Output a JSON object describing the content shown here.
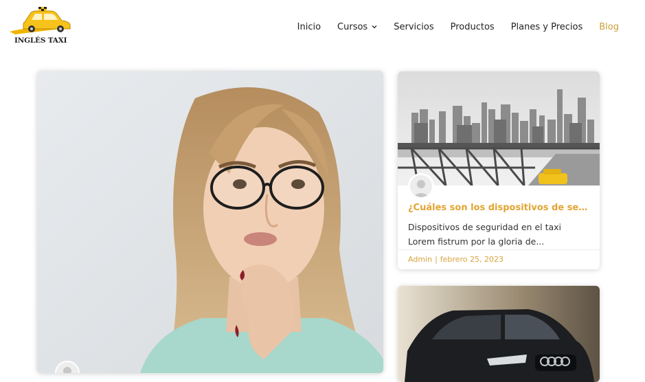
{
  "brand": {
    "name": "INGLÉS TAXI",
    "accent": "#f5b800"
  },
  "nav": {
    "items": [
      {
        "label": "Inicio"
      },
      {
        "label": "Cursos"
      },
      {
        "label": "Servicios"
      },
      {
        "label": "Productos"
      },
      {
        "label": "Planes y Precios"
      },
      {
        "label": "Blog"
      }
    ],
    "active_color": "#c9a13a"
  },
  "featured_post": {
    "image": "woman-thinking-photo"
  },
  "posts": [
    {
      "image": "city-bridge-taxi-photo",
      "title": "¿Cuáles son los dispositivos de seguridad en el taxi?",
      "excerpt": "Dispositivos de seguridad en el taxi Lorem fistrum por la gloria de...",
      "author": "Admin",
      "date": "febrero 25, 2023"
    },
    {
      "image": "black-car-photo"
    }
  ],
  "colors": {
    "title": "#e2a532",
    "meta": "#d9a33c"
  }
}
